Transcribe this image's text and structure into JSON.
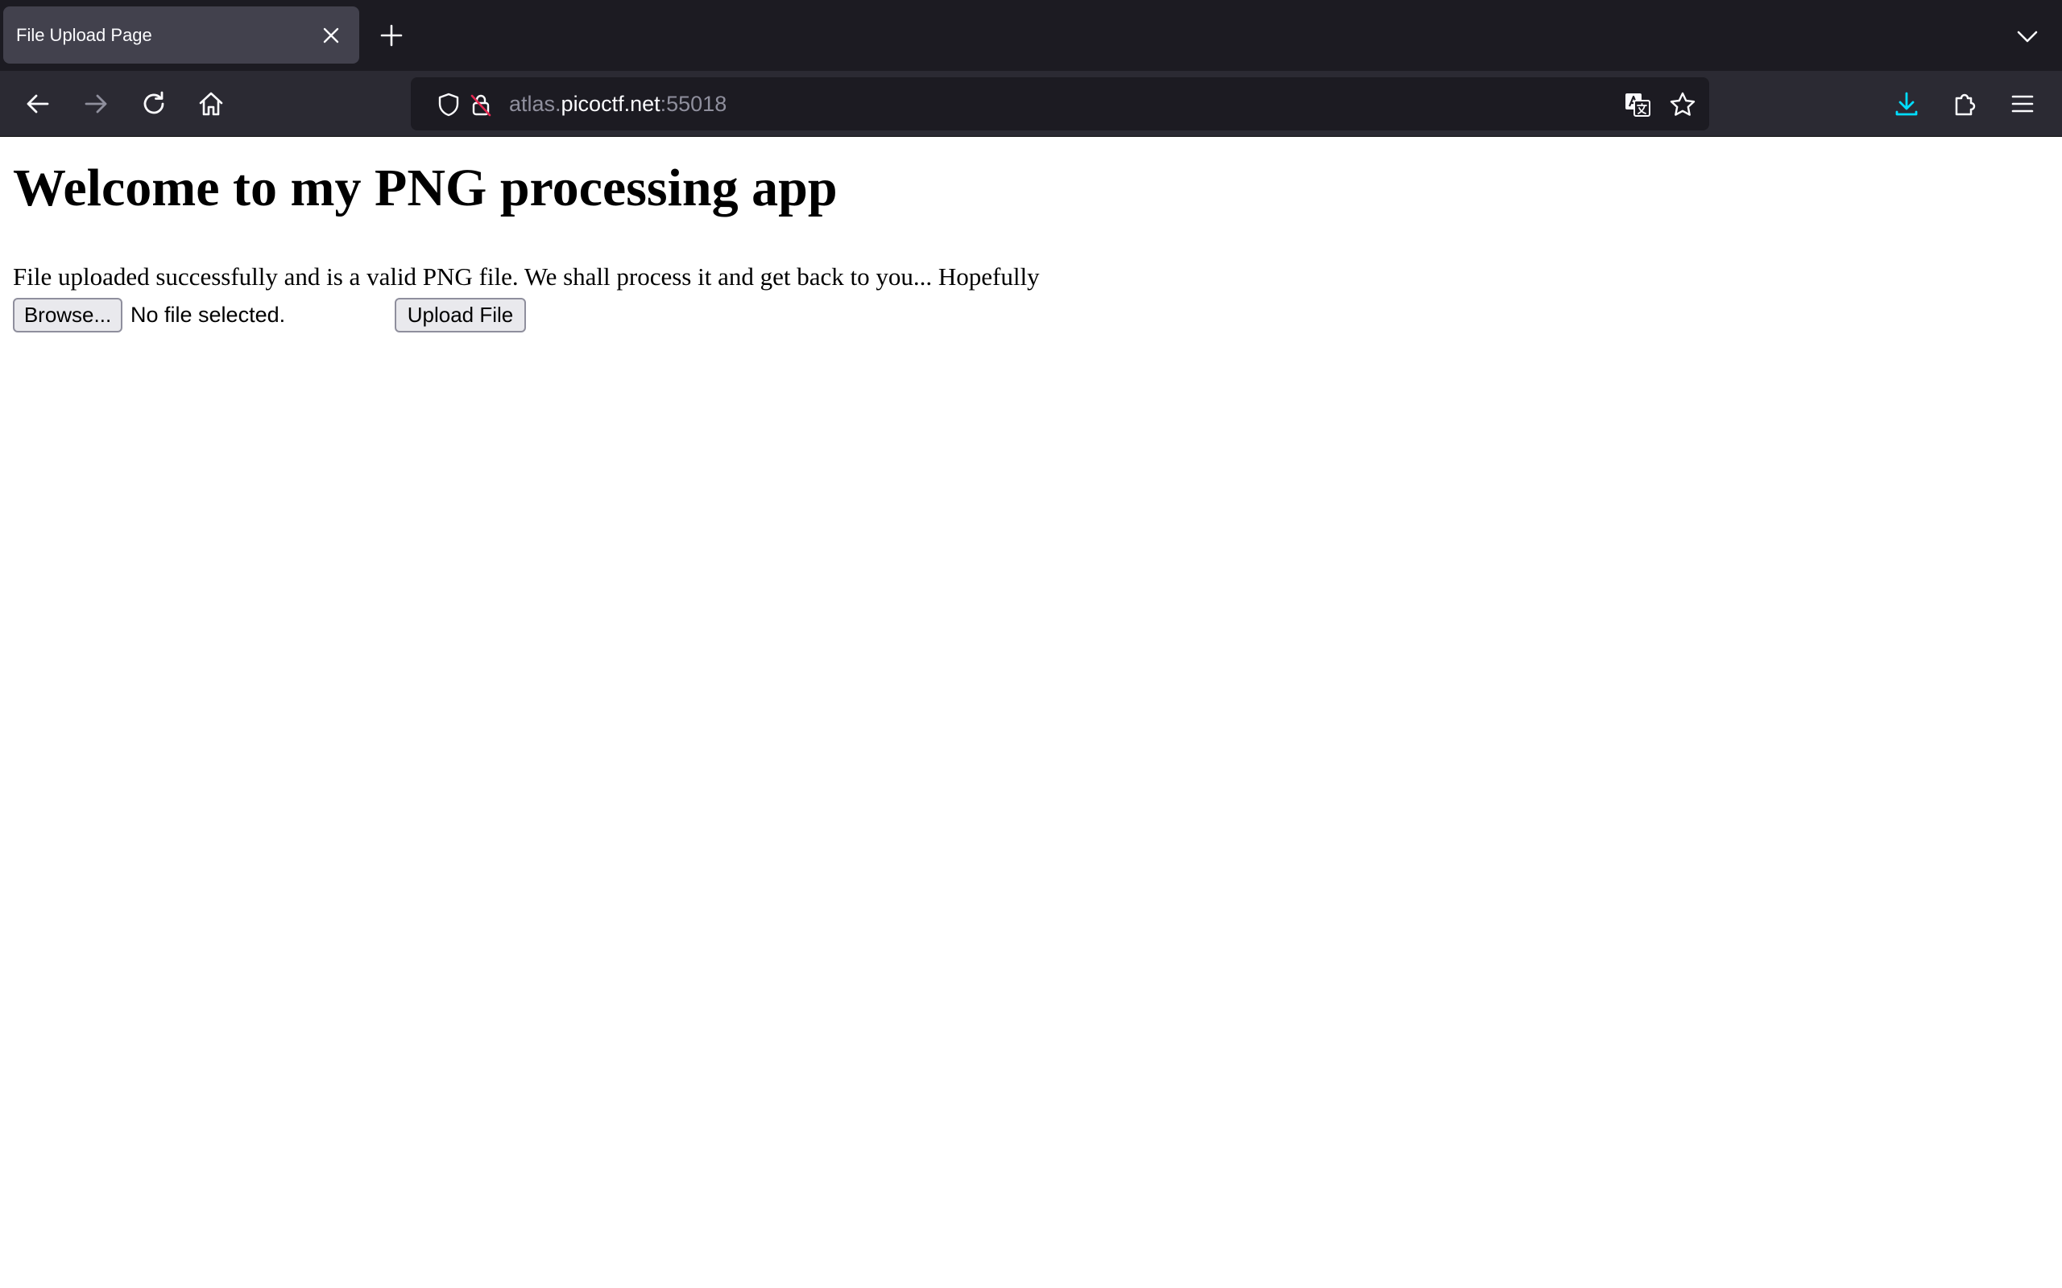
{
  "browser": {
    "tab": {
      "title": "File Upload Page"
    },
    "url": {
      "subdomain": "atlas.",
      "domain": "picoctf.net",
      "port": ":55018"
    },
    "icons": {
      "tab_close": "close-icon",
      "new_tab": "plus-icon",
      "tab_list": "chevron-down-icon",
      "back": "back-arrow-icon",
      "forward": "forward-arrow-icon",
      "reload": "reload-icon",
      "home": "home-icon",
      "tracking_protection": "shield-icon",
      "insecure": "insecure-lock-icon",
      "translate": "translate-icon",
      "bookmark": "star-icon",
      "downloads": "download-icon",
      "extensions": "puzzle-icon",
      "menu": "hamburger-menu-icon"
    },
    "colors": {
      "chrome_dark": "#1c1b22",
      "toolbar": "#2b2a33",
      "tab_active": "#42414d",
      "download_accent": "#00ddff"
    }
  },
  "page": {
    "heading": "Welcome to my PNG processing app",
    "status_message": "File uploaded successfully and is a valid PNG file. We shall process it and get back to you... Hopefully",
    "form": {
      "browse_label": "Browse...",
      "file_status": "No file selected.",
      "upload_label": "Upload File"
    }
  }
}
